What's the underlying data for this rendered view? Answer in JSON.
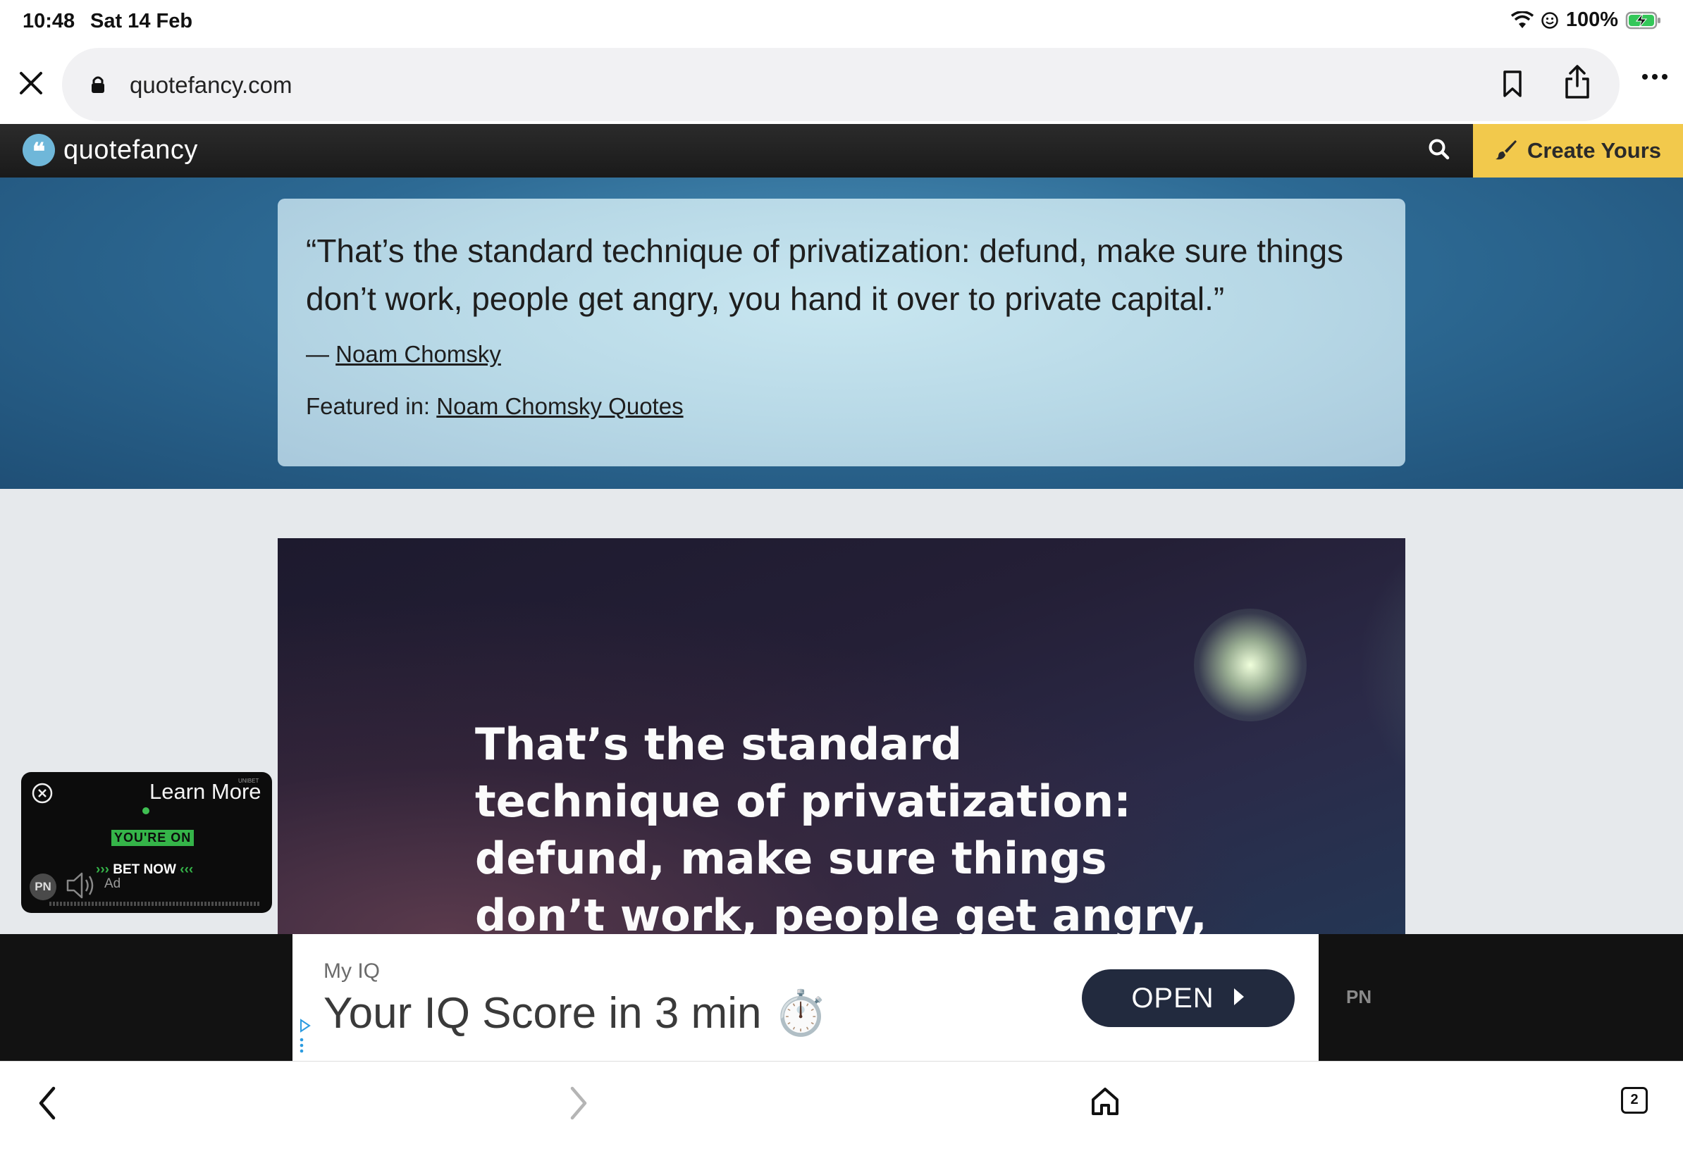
{
  "status": {
    "time": "10:48",
    "date": "Sat 14 Feb",
    "battery_percent": "100%",
    "battery_charging": true
  },
  "browser": {
    "url": "quotefancy.com",
    "icons": [
      "close-icon",
      "lock-icon",
      "bookmark-icon",
      "share-icon",
      "more-icon"
    ]
  },
  "site_header": {
    "logo_text": "quotefancy",
    "logo_glyph": "❝",
    "create_label": "Create Yours",
    "accent_color": "#f2c94c"
  },
  "quote_card": {
    "text": "“That’s the standard technique of privatization: defund, make sure things don’t work, people get angry, you hand it over to private capital.”",
    "author_prefix": "— ",
    "author": "Noam Chomsky",
    "featured_prefix": "Featured in: ",
    "featured_link": "Noam Chomsky Quotes"
  },
  "wallpaper": {
    "quote": "That’s the standard technique of privatization: defund, make sure things don’t work, people get angry, you hand it over to private capital."
  },
  "video_ad": {
    "learn_more": "Learn More",
    "tiny_label": "UNIBET",
    "youre_on": "YOU'RE ON",
    "bet_now": "BET NOW",
    "chev_left": "›››",
    "chev_right": "‹‹‹",
    "pn": "PN",
    "ad_label": "Ad"
  },
  "banner_ad": {
    "brand": "My IQ",
    "headline": "Your IQ Score in 3 min ⏱️",
    "cta": "OPEN",
    "pn": "PN"
  },
  "toolbar": {
    "tabs_count": "2"
  }
}
